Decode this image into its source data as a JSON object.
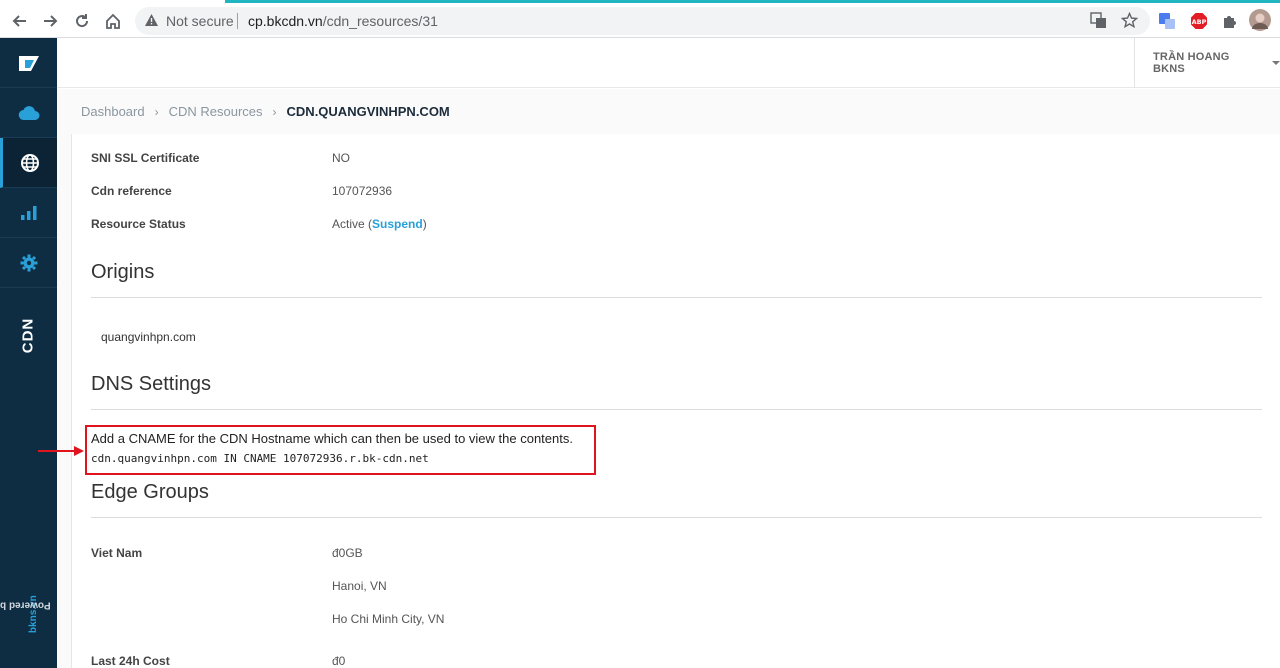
{
  "browser": {
    "security_label": "Not secure",
    "url_domain": "cp.bkcdn.vn",
    "url_path": "/cdn_resources/31"
  },
  "sidebar": {
    "section_label": "CDN",
    "powered_prefix": "Powered by ",
    "powered_brand": "bkns.vn"
  },
  "header": {
    "user_name": "TRẦN HOANG BKNS"
  },
  "breadcrumb": {
    "items": [
      "Dashboard",
      "CDN Resources"
    ],
    "current": "CDN.QUANGVINHPN.COM"
  },
  "details": [
    {
      "label": "SNI SSL Certificate",
      "value": "NO"
    },
    {
      "label": "Cdn reference",
      "value": "107072936"
    },
    {
      "label": "Resource Status",
      "value": "Active (",
      "link": "Suspend",
      "suffix": ")"
    }
  ],
  "origins": {
    "title": "Origins",
    "items": [
      "quangvinhpn.com"
    ]
  },
  "dns": {
    "title": "DNS Settings",
    "description": "Add a CNAME for the CDN Hostname which can then be used to view the contents.",
    "record": "cdn.quangvinhpn.com IN CNAME 107072936.r.bk-cdn.net"
  },
  "edge_groups": {
    "title": "Edge Groups",
    "group_label": "Viet Nam",
    "group_values": [
      "đ0GB",
      "Hanoi, VN",
      "Ho Chi Minh City, VN"
    ],
    "cost_label": "Last 24h Cost",
    "cost_value": "đ0"
  },
  "colors": {
    "sidebar_bg": "#0e2c42",
    "accent": "#2aa0d8",
    "highlight_box": "#e0141e"
  }
}
